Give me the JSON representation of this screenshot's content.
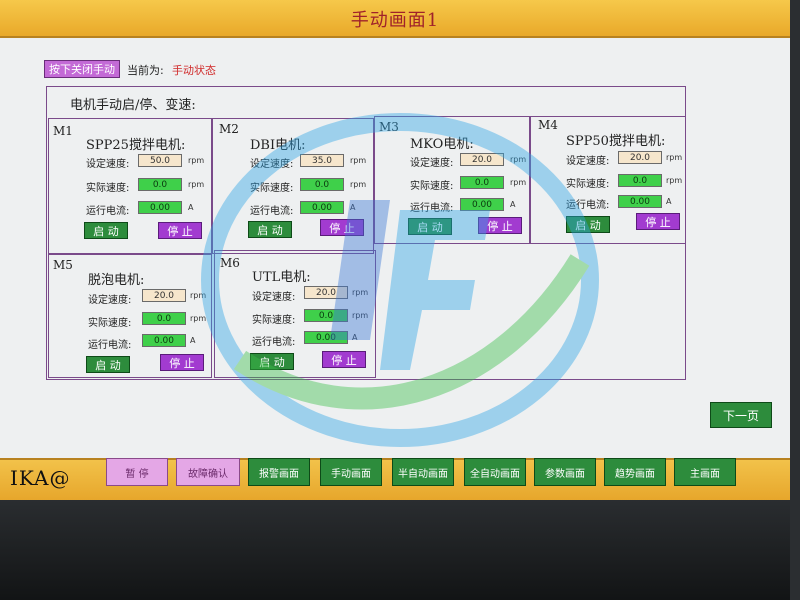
{
  "title": "手动画面1",
  "top": {
    "close_manual_button": "按下关闭手动",
    "status_label": "当前为:",
    "status_value": "手动状态"
  },
  "section_title": "电机手动启/停、变速:",
  "labels": {
    "set_speed": "设定速度:",
    "actual_speed": "实际速度:",
    "current": "运行电流:",
    "unit_rpm": "rpm",
    "unit_amp": "A",
    "start": "启 动",
    "stop": "停 止"
  },
  "motors": [
    {
      "tag": "M1",
      "name": "SPP25搅拌电机:",
      "set": "50.0",
      "actual": "0.0",
      "current": "0.00"
    },
    {
      "tag": "M2",
      "name": "DBI电机:",
      "set": "35.0",
      "actual": "0.0",
      "current": "0.00"
    },
    {
      "tag": "M3",
      "name": "MKO电机:",
      "set": "20.0",
      "actual": "0.0",
      "current": "0.00"
    },
    {
      "tag": "M4",
      "name": "SPP50搅拌电机:",
      "set": "20.0",
      "actual": "0.0",
      "current": "0.00"
    },
    {
      "tag": "M5",
      "name": "脱泡电机:",
      "set": "20.0",
      "actual": "0.0",
      "current": "0.00"
    },
    {
      "tag": "M6",
      "name": "UTL电机:",
      "set": "20.0",
      "actual": "0.0",
      "current": "0.00"
    }
  ],
  "next_page": "下一页",
  "brand": "IKA@",
  "nav": [
    "暂 停",
    "故障确认",
    "报警画面",
    "手动画面",
    "半自动画面",
    "全自动画面",
    "参数画面",
    "趋势画面",
    "主画面"
  ]
}
